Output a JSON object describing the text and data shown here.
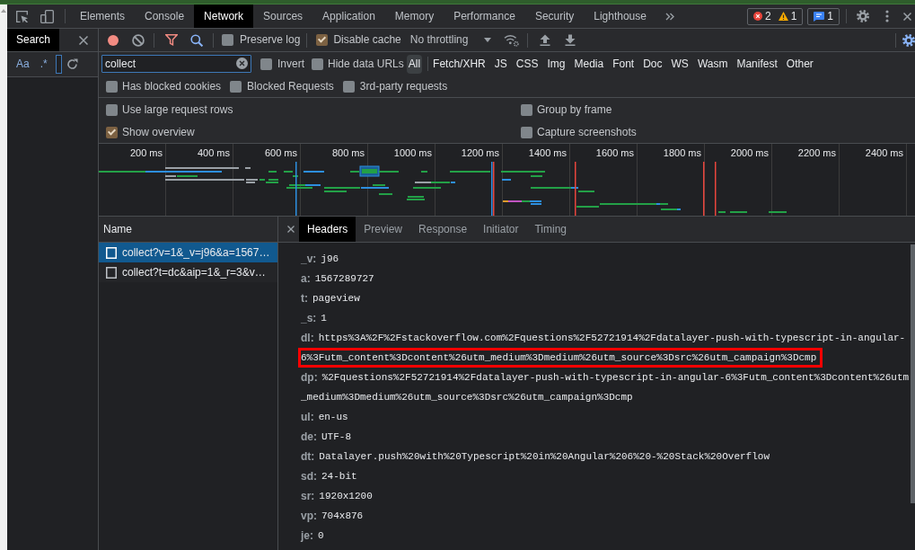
{
  "devtools_tabs": [
    {
      "label": "Elements",
      "selected": false
    },
    {
      "label": "Console",
      "selected": false
    },
    {
      "label": "Network",
      "selected": true
    },
    {
      "label": "Sources",
      "selected": false
    },
    {
      "label": "Application",
      "selected": false
    },
    {
      "label": "Memory",
      "selected": false
    },
    {
      "label": "Performance",
      "selected": false
    },
    {
      "label": "Security",
      "selected": false
    },
    {
      "label": "Lighthouse",
      "selected": false
    }
  ],
  "issue_counts": {
    "errors": "2",
    "warnings": "1",
    "messages": "1"
  },
  "drawer": {
    "tab": {
      "label": "Search",
      "selected": true
    },
    "match_case": "Aa",
    "regex": ".*"
  },
  "toolbar": {
    "recording": true,
    "preserve_log": {
      "label": "Preserve log",
      "checked": false
    },
    "disable_cache": {
      "label": "Disable cache",
      "checked": true
    },
    "throttling": "No throttling"
  },
  "filter": {
    "value": "collect",
    "invert": {
      "label": "Invert",
      "checked": false
    },
    "hide_data_urls": {
      "label": "Hide data URLs",
      "checked": false
    },
    "types": [
      {
        "label": "All",
        "selected": true
      },
      {
        "label": "Fetch/XHR",
        "selected": false
      },
      {
        "label": "JS",
        "selected": false
      },
      {
        "label": "CSS",
        "selected": false
      },
      {
        "label": "Img",
        "selected": false
      },
      {
        "label": "Media",
        "selected": false
      },
      {
        "label": "Font",
        "selected": false
      },
      {
        "label": "Doc",
        "selected": false
      },
      {
        "label": "WS",
        "selected": false
      },
      {
        "label": "Wasm",
        "selected": false
      },
      {
        "label": "Manifest",
        "selected": false
      },
      {
        "label": "Other",
        "selected": false
      }
    ]
  },
  "filter_options": [
    {
      "label": "Has blocked cookies",
      "checked": false
    },
    {
      "label": "Blocked Requests",
      "checked": false
    },
    {
      "label": "3rd-party requests",
      "checked": false
    }
  ],
  "settings": [
    {
      "label": "Use large request rows",
      "checked": false
    },
    {
      "label": "Group by frame",
      "checked": false
    },
    {
      "label": "Show overview",
      "checked": true
    },
    {
      "label": "Capture screenshots",
      "checked": false
    }
  ],
  "overview": {
    "ticks": [
      "200 ms",
      "400 ms",
      "600 ms",
      "800 ms",
      "1000 ms",
      "1200 ms",
      "1400 ms",
      "1600 ms",
      "1800 ms",
      "2000 ms",
      "2200 ms",
      "2400 ms"
    ]
  },
  "requests": {
    "column": "Name",
    "rows": [
      {
        "name": "collect?v=1&_v=j96&a=1567…",
        "selected": true
      },
      {
        "name": "collect?t=dc&aip=1&_r=3&v…",
        "selected": false
      }
    ]
  },
  "details": {
    "tabs": [
      {
        "label": "Headers",
        "selected": true
      },
      {
        "label": "Preview",
        "selected": false
      },
      {
        "label": "Response",
        "selected": false
      },
      {
        "label": "Initiator",
        "selected": false
      },
      {
        "label": "Timing",
        "selected": false
      }
    ],
    "headers": [
      {
        "key": "_v:",
        "lines": [
          {
            "text": "j96",
            "highlighted": false
          }
        ]
      },
      {
        "key": "a:",
        "lines": [
          {
            "text": "1567289727",
            "highlighted": false
          }
        ]
      },
      {
        "key": "t:",
        "lines": [
          {
            "text": "pageview",
            "highlighted": false
          }
        ]
      },
      {
        "key": "_s:",
        "lines": [
          {
            "text": "1",
            "highlighted": false
          }
        ]
      },
      {
        "key": "dl:",
        "lines": [
          {
            "text": "https%3A%2F%2Fstackoverflow.com%2Fquestions%2F52721914%2Fdatalayer-push-with-typescript-in-angular-",
            "highlighted": false
          },
          {
            "text": "6%3Futm_content%3Dcontent%26utm_medium%3Dmedium%26utm_source%3Dsrc%26utm_campaign%3Dcmp",
            "highlighted": true
          }
        ]
      },
      {
        "key": "dp:",
        "lines": [
          {
            "text": "%2Fquestions%2F52721914%2Fdatalayer-push-with-typescript-in-angular-6%3Futm_content%3Dcontent%26utm",
            "highlighted": false
          },
          {
            "text": "_medium%3Dmedium%26utm_source%3Dsrc%26utm_campaign%3Dcmp",
            "highlighted": false
          }
        ]
      },
      {
        "key": "ul:",
        "lines": [
          {
            "text": "en-us",
            "highlighted": false
          }
        ]
      },
      {
        "key": "de:",
        "lines": [
          {
            "text": "UTF-8",
            "highlighted": false
          }
        ]
      },
      {
        "key": "dt:",
        "lines": [
          {
            "text": "Datalayer.push%20with%20Typescript%20in%20Angular%206%20-%20Stack%20Overflow",
            "highlighted": false
          }
        ]
      },
      {
        "key": "sd:",
        "lines": [
          {
            "text": "24-bit",
            "highlighted": false
          }
        ]
      },
      {
        "key": "sr:",
        "lines": [
          {
            "text": "1920x1200",
            "highlighted": false
          }
        ]
      },
      {
        "key": "vp:",
        "lines": [
          {
            "text": "704x876",
            "highlighted": false
          }
        ]
      },
      {
        "key": "je:",
        "lines": [
          {
            "text": "0",
            "highlighted": false
          }
        ]
      }
    ]
  }
}
